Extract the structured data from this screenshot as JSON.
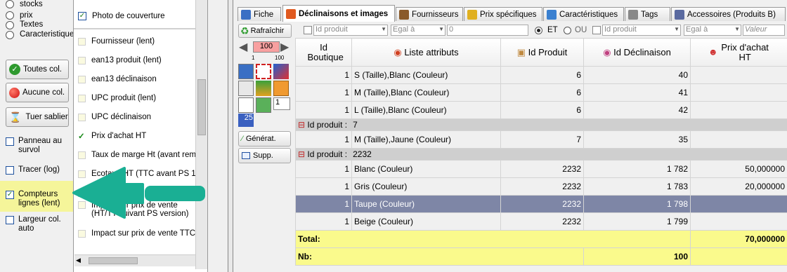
{
  "left_panel": {
    "radios": [
      "stocks",
      "prix",
      "Textes",
      "Caracteristique"
    ],
    "buttons": {
      "all": "Toutes col.",
      "none": "Aucune col.",
      "kill": "Tuer sablier"
    },
    "checks": [
      {
        "label": "Panneau au survol",
        "checked": false
      },
      {
        "label": "Tracer (log)",
        "checked": false
      },
      {
        "label": "Compteurs lignes (lent)",
        "checked": true
      },
      {
        "label": "Largeur col. auto",
        "checked": false
      }
    ]
  },
  "column_list": {
    "top_item": "Photo de couverture",
    "items": [
      {
        "label": "Fournisseur (lent)",
        "checked": false
      },
      {
        "label": "ean13 produit (lent)",
        "checked": false
      },
      {
        "label": "ean13 déclinaison",
        "checked": false
      },
      {
        "label": "UPC produit (lent)",
        "checked": false
      },
      {
        "label": "UPC déclinaison",
        "checked": false
      },
      {
        "label": "Prix d'achat HT",
        "checked": true
      },
      {
        "label": "Taux de marge Ht (avant remise",
        "checked": false
      },
      {
        "label": "Ecotaxe HT (TTC avant PS 1.4)",
        "checked": false
      },
      {
        "label": "",
        "checked": false
      },
      {
        "label": "Impact sur prix de vente (HT/TT suivant PS version)",
        "checked": false
      },
      {
        "label": "Impact sur prix de vente TTC",
        "checked": false
      }
    ]
  },
  "tabs": [
    {
      "label": "Fiche",
      "color": "#3a6fc4"
    },
    {
      "label": "Déclinaisons et images",
      "color": "#e05a20",
      "active": true
    },
    {
      "label": "Fournisseurs",
      "color": "#8a5a2a"
    },
    {
      "label": "Prix spécifiques",
      "color": "#e0b020"
    },
    {
      "label": "Caractéristiques",
      "color": "#3a80d0"
    },
    {
      "label": "Tags",
      "color": "#888888"
    },
    {
      "label": "Accessoires (Produits B)",
      "color": "#5a6aa0"
    }
  ],
  "filter": {
    "field1": "Id produit",
    "op1": "Egal à",
    "value1": "0",
    "et": "ET",
    "ou": "OU",
    "field2": "Id produit",
    "op2": "Egal à",
    "value2_placeholder": "Valeur"
  },
  "toolbar": {
    "refresh": "Rafraîchir",
    "page": "100",
    "min": "1",
    "max": "100",
    "spin": "1",
    "count": "25",
    "generate": "Générat.",
    "delete": "Supp."
  },
  "grid": {
    "headers": [
      "Id Boutique",
      "Liste attributs",
      "Id Produit",
      "Id Déclinaison",
      "Prix d'achat HT"
    ],
    "group_label": "Id produit :",
    "rows": [
      {
        "type": "row",
        "c": [
          "1",
          "S (Taille),Blanc (Couleur)",
          "6",
          "40",
          ""
        ]
      },
      {
        "type": "row",
        "c": [
          "1",
          "M (Taille),Blanc (Couleur)",
          "6",
          "41",
          ""
        ]
      },
      {
        "type": "row",
        "c": [
          "1",
          "L (Taille),Blanc (Couleur)",
          "6",
          "42",
          ""
        ]
      },
      {
        "type": "group",
        "value": "7"
      },
      {
        "type": "row",
        "c": [
          "1",
          "M (Taille),Jaune (Couleur)",
          "7",
          "35",
          ""
        ]
      },
      {
        "type": "group",
        "value": "2232"
      },
      {
        "type": "row",
        "c": [
          "1",
          "Blanc (Couleur)",
          "2232",
          "1 782",
          "50,000000"
        ]
      },
      {
        "type": "row",
        "c": [
          "1",
          "Gris (Couleur)",
          "2232",
          "1 783",
          "20,000000"
        ]
      },
      {
        "type": "sel",
        "c": [
          "1",
          "Taupe (Couleur)",
          "2232",
          "1 798",
          ""
        ]
      },
      {
        "type": "row",
        "c": [
          "1",
          "Beige (Couleur)",
          "2232",
          "1 799",
          ""
        ]
      }
    ],
    "total_label": "Total:",
    "total_value": "70,000000",
    "nb_label": "Nb:",
    "nb_value": "100"
  }
}
